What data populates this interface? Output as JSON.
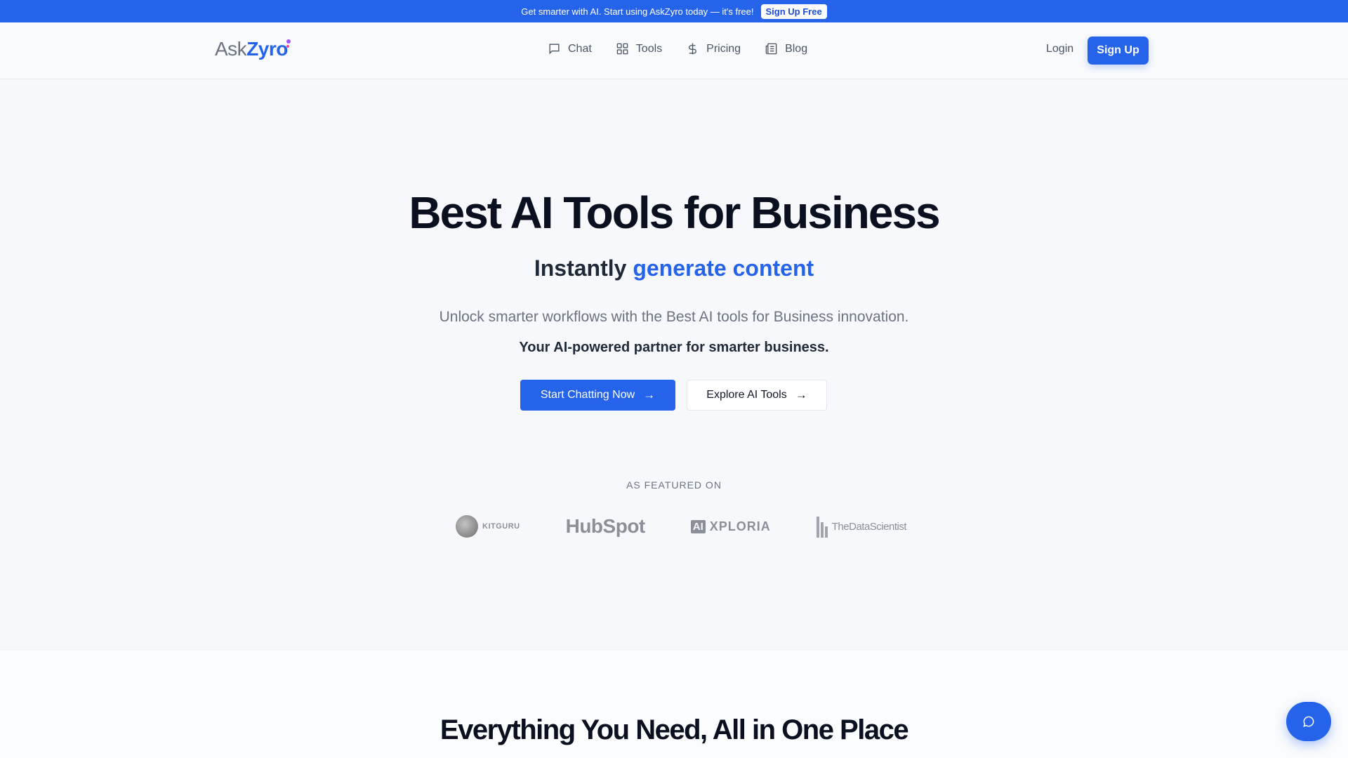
{
  "announcement": {
    "text": "Get smarter with AI. Start using AskZyro today — it's free!",
    "button_label": "Sign Up Free"
  },
  "header": {
    "logo_prefix": "Ask",
    "logo_suffix": "Zyro",
    "nav": [
      {
        "label": "Chat",
        "icon": "chat-icon"
      },
      {
        "label": "Tools",
        "icon": "grid-icon"
      },
      {
        "label": "Pricing",
        "icon": "dollar-icon"
      },
      {
        "label": "Blog",
        "icon": "newspaper-icon"
      }
    ],
    "login_label": "Login",
    "signup_label": "Sign Up"
  },
  "hero": {
    "title": "Best AI Tools for Business",
    "subtitle_prefix": "Instantly",
    "subtitle_accent": "generate content",
    "description": "Unlock smarter workflows with the Best AI tools for Business innovation.",
    "tagline": "Your AI-powered partner for smarter business.",
    "primary_cta": "Start Chatting Now",
    "secondary_cta": "Explore AI Tools"
  },
  "featured": {
    "label": "AS FEATURED ON",
    "logos": [
      {
        "name": "KitGuru",
        "text": "KITGURU"
      },
      {
        "name": "HubSpot",
        "text": "HubSpot"
      },
      {
        "name": "AIXPLORIA",
        "box": "AI",
        "text": "XPLORIA"
      },
      {
        "name": "TheDataScientist",
        "text": "TheDataScientist"
      }
    ]
  },
  "section2": {
    "title": "Everything You Need, All in One Place"
  },
  "colors": {
    "accent": "#2563eb",
    "text_dark": "#0b1020",
    "text_muted": "#6b7280"
  }
}
